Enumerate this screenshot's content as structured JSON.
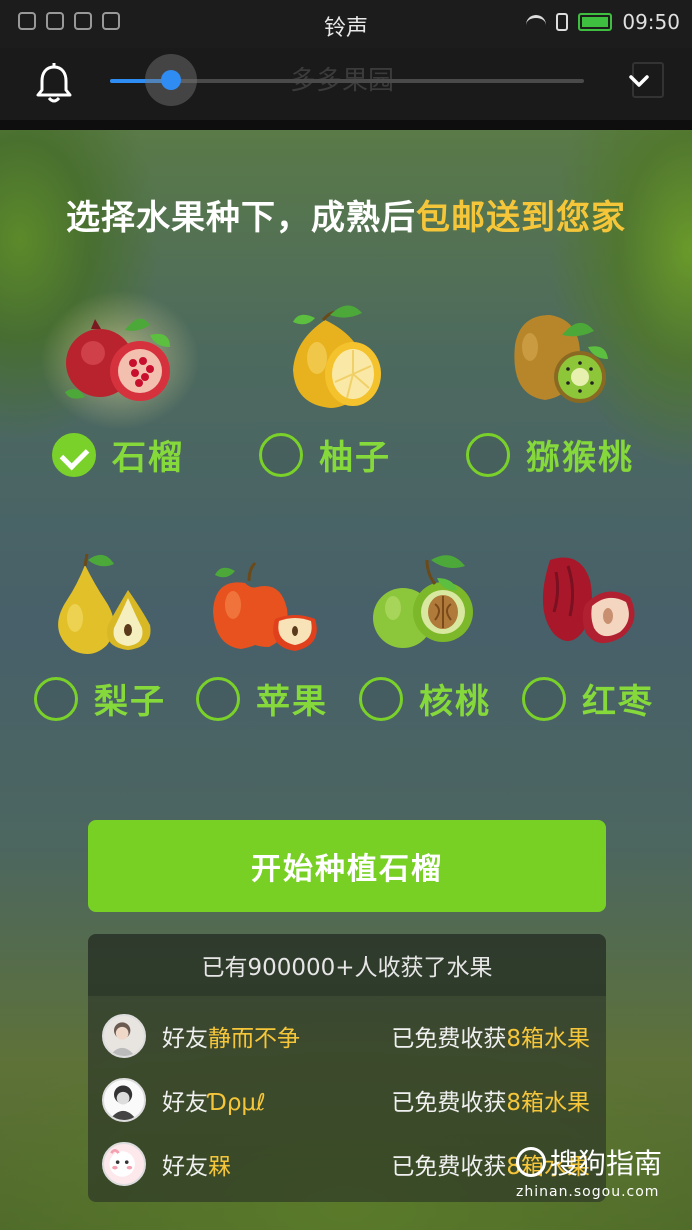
{
  "status_bar": {
    "title": "铃声",
    "time": "09:50"
  },
  "volume": {
    "level": 0.13,
    "ghost_title": "多多果园"
  },
  "headline": {
    "text": "选择水果种下，成熟后",
    "highlight": "包邮送到您家"
  },
  "fruits": [
    {
      "label": "石榴",
      "checked": true,
      "icon": "pomegranate-icon"
    },
    {
      "label": "柚子",
      "checked": false,
      "icon": "pomelo-icon"
    },
    {
      "label": "猕猴桃",
      "checked": false,
      "icon": "kiwi-icon"
    },
    {
      "label": "梨子",
      "checked": false,
      "icon": "pear-icon"
    },
    {
      "label": "苹果",
      "checked": false,
      "icon": "apple-icon"
    },
    {
      "label": "核桃",
      "checked": false,
      "icon": "walnut-icon"
    },
    {
      "label": "红枣",
      "checked": false,
      "icon": "jujube-icon"
    }
  ],
  "start_button": {
    "label": "开始种植石榴"
  },
  "harvest_panel": {
    "header": "已有900000+人收获了水果",
    "rows": [
      {
        "prefix": "好友",
        "name": "静而不争",
        "harvest_prefix": "已免费收获",
        "harvest_amount": "8箱水果"
      },
      {
        "prefix": "好友",
        "name": "Ɗρμℓ",
        "harvest_prefix": "已免费收获",
        "harvest_amount": "8箱水果"
      },
      {
        "prefix": "好友",
        "name": "槑",
        "harvest_prefix": "已免费收获",
        "harvest_amount": "8箱水果"
      }
    ]
  },
  "watermark": {
    "brand": "搜狗指南",
    "url": "zhinan.sogou.com"
  },
  "colors": {
    "accent_green": "#78d024",
    "label_green": "#86d93a",
    "highlight_yellow": "#f6c63a",
    "slider_blue": "#2f8cf2"
  }
}
